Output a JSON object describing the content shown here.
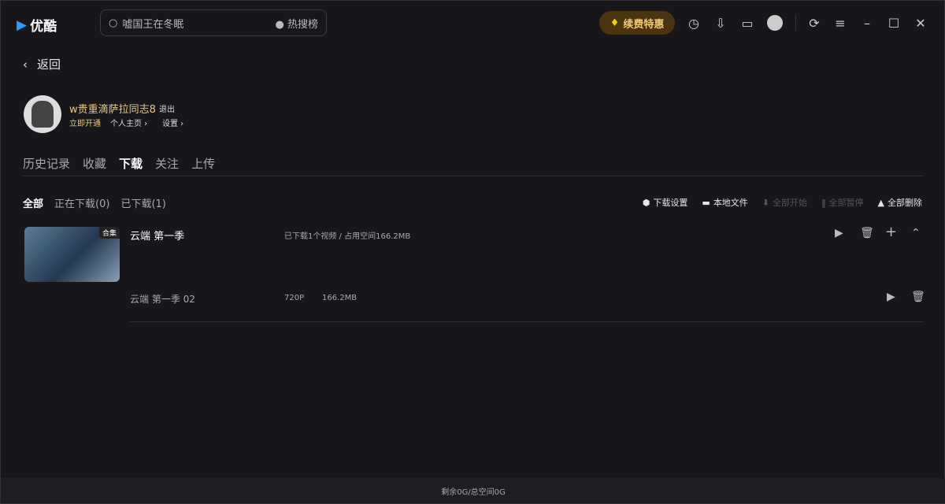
{
  "app": {
    "name": "优酷"
  },
  "search": {
    "query": "嘘国王在冬眠",
    "hot": "热搜榜"
  },
  "header": {
    "vip": "续费特惠"
  },
  "back": "返回",
  "user": {
    "name": "w贵重滴萨拉同志8",
    "logout": "退出",
    "open": "立即开通",
    "home": "个人主页 ›",
    "settings": "设置 ›"
  },
  "tabs": [
    "历史记录",
    "收藏",
    "下载",
    "关注",
    "上传"
  ],
  "filters": [
    "全部",
    "正在下载(0)",
    "已下载(1)"
  ],
  "actions": {
    "settings": "下载设置",
    "local": "本地文件",
    "start_all": "全部开始",
    "pause_all": "全部暂停",
    "delete_all": "全部删除"
  },
  "item": {
    "badge": "合集",
    "title": "云端 第一季",
    "info": "已下载1个视频 / 占用空间166.2MB",
    "episode": {
      "title": "云端 第一季 02",
      "quality": "720P",
      "size": "166.2MB"
    }
  },
  "footer": "剩余0G/总空间0G"
}
